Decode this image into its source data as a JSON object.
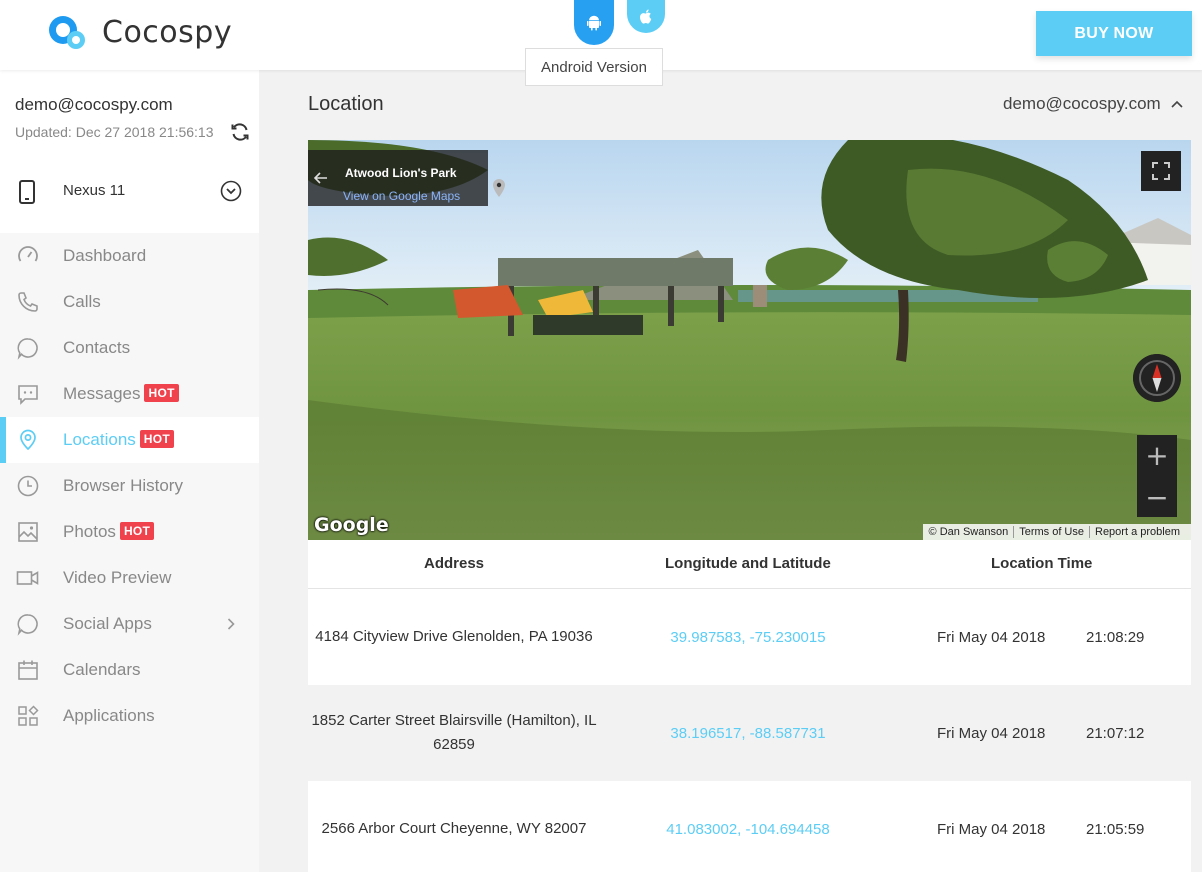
{
  "header": {
    "logo_text": "Cocospy",
    "os_tooltip": "Android Version",
    "buy_label": "BUY NOW",
    "icons": [
      "cocospy-logo-icon",
      "android-icon",
      "apple-icon"
    ]
  },
  "sidebar": {
    "email": "demo@cocospy.com",
    "updated": "Updated: Dec 27 2018 21:56:13",
    "device": "Nexus 11",
    "items": [
      {
        "label": "Dashboard",
        "icon": "dashboard-icon"
      },
      {
        "label": "Calls",
        "icon": "phone-icon"
      },
      {
        "label": "Contacts",
        "icon": "contacts-icon"
      },
      {
        "label": "Messages",
        "icon": "message-icon",
        "badge": "HOT"
      },
      {
        "label": "Locations",
        "icon": "location-pin-icon",
        "badge": "HOT",
        "active": true
      },
      {
        "label": "Browser History",
        "icon": "clock-icon"
      },
      {
        "label": "Photos",
        "icon": "photo-icon",
        "badge": "HOT"
      },
      {
        "label": "Video Preview",
        "icon": "video-icon"
      },
      {
        "label": "Social Apps",
        "icon": "social-icon",
        "has_submenu": true
      },
      {
        "label": "Calendars",
        "icon": "calendar-icon"
      },
      {
        "label": "Applications",
        "icon": "apps-icon"
      }
    ]
  },
  "main": {
    "title": "Location",
    "user_email": "demo@cocospy.com",
    "panorama": {
      "place": "Atwood Lion's Park",
      "link": "View on Google Maps",
      "google_logo": "Google",
      "attribution": [
        "© Dan Swanson",
        "Terms of Use",
        "Report a problem"
      ]
    },
    "table": {
      "headers": {
        "address": "Address",
        "coords": "Longitude and Latitude",
        "time": "Location Time"
      },
      "rows": [
        {
          "address": "4184 Cityview Drive Glenolden, PA 19036",
          "coords": "39.987583, -75.230015",
          "date": "Fri May 04 2018",
          "time": "21:08:29"
        },
        {
          "address": "1852 Carter Street Blairsville (Hamilton), IL 62859",
          "coords": "38.196517, -88.587731",
          "date": "Fri May 04 2018",
          "time": "21:07:12"
        },
        {
          "address": "2566 Arbor Court Cheyenne, WY 82007",
          "coords": "41.083002, -104.694458",
          "date": "Fri May 04 2018",
          "time": "21:05:59"
        }
      ]
    }
  },
  "colors": {
    "accent": "#5ccdf5",
    "android_blue": "#27a0f2",
    "hot_badge": "#f0424d"
  }
}
